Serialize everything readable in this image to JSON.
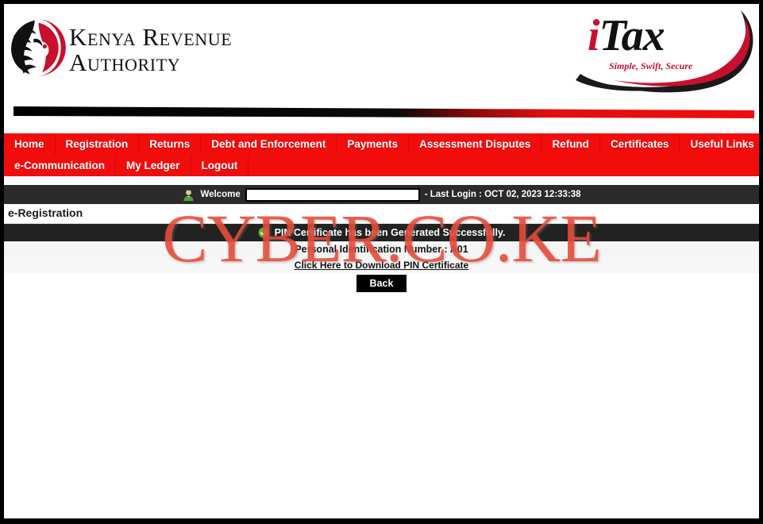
{
  "brand": {
    "kra_line1": "Kenya Revenue",
    "kra_line2": "Authority",
    "itax_i": "i",
    "itax_rest": "Tax",
    "itax_tagline": "Simple, Swift, Secure"
  },
  "nav": {
    "row1": [
      {
        "label": "Home"
      },
      {
        "label": "Registration"
      },
      {
        "label": "Returns"
      },
      {
        "label": "Debt and Enforcement"
      },
      {
        "label": "Payments"
      },
      {
        "label": "Assessment Disputes"
      },
      {
        "label": "Refund"
      },
      {
        "label": "Certificates"
      },
      {
        "label": "Useful Links"
      }
    ],
    "row2": [
      {
        "label": "e-Communication"
      },
      {
        "label": "My Ledger"
      },
      {
        "label": "Logout"
      }
    ]
  },
  "welcome": {
    "avatar_icon": "user-avatar-icon",
    "label": "Welcome",
    "username_redacted": "",
    "last_login": "- Last Login : OCT 02, 2023 12:33:38"
  },
  "page": {
    "title": "e-Registration"
  },
  "message": {
    "status_icon": "green-check-circle-icon",
    "success_text": "PIN Certificate has been Generated Successfully.",
    "pin_text": "Personal Identification Number : A01",
    "download_link": "Click Here to Download PIN Certificate",
    "back_label": "Back"
  },
  "watermark": {
    "text": "CYBER.CO.KE"
  },
  "colors": {
    "nav_red": "#f20c0c",
    "brand_red": "#c8102e",
    "dark_bar": "#222222",
    "welcome_bar": "#2b2b2b",
    "watermark_red": "#e84a38",
    "success_green": "#5cb531"
  }
}
